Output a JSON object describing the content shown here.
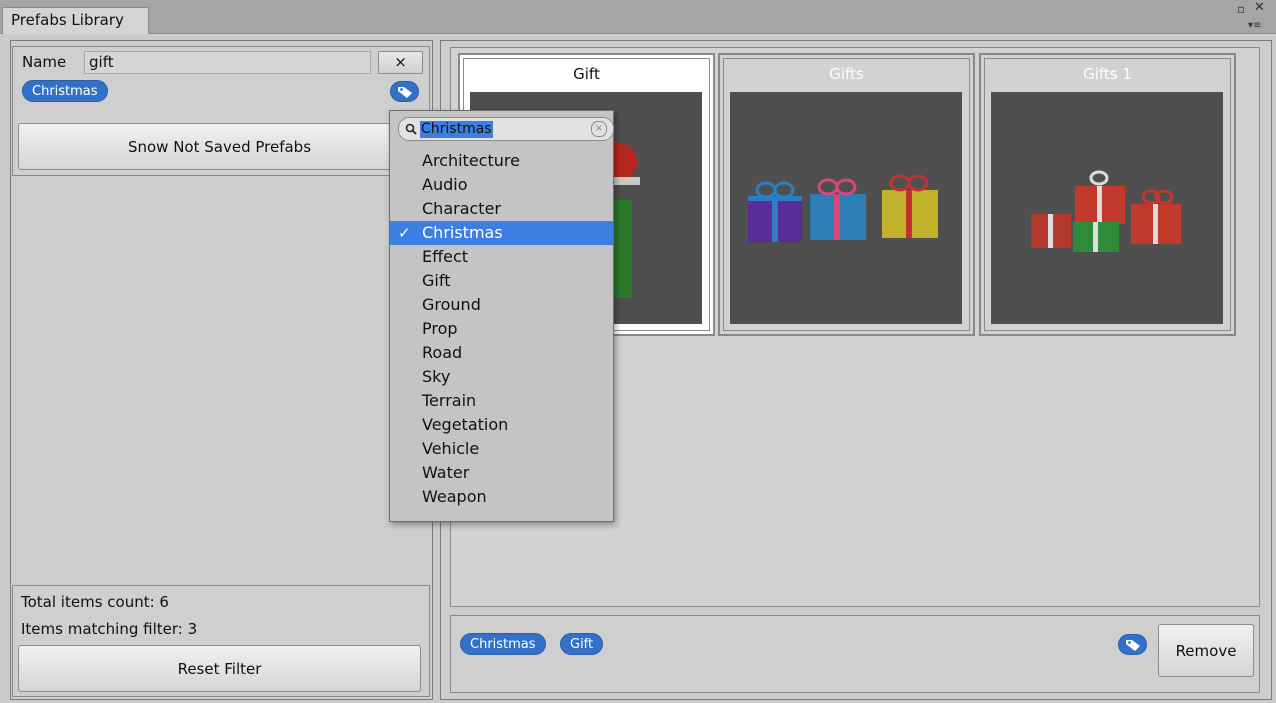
{
  "window": {
    "tab_title": "Prefabs Library",
    "ctrl_maximize": "▫",
    "ctrl_close": "✕",
    "ctrl_menu": "▾≡"
  },
  "filter": {
    "name_label": "Name",
    "name_value": "gift",
    "clear_button": "×",
    "active_tags": [
      "Christmas"
    ],
    "snow_button": "Snow Not Saved Prefabs"
  },
  "info": {
    "total_items": "Total items count: 6",
    "matching_items": "Items matching filter: 3",
    "reset_button": "Reset Filter"
  },
  "grid": {
    "cards": [
      {
        "title": "Gift",
        "selected": true
      },
      {
        "title": "Gifts",
        "selected": false
      },
      {
        "title": "Gifts 1",
        "selected": false
      }
    ]
  },
  "selection": {
    "tags": [
      "Christmas",
      "Gift"
    ],
    "remove_button": "Remove"
  },
  "tag_dropdown": {
    "search_value": "Christmas",
    "items": [
      {
        "label": "Architecture",
        "checked": false
      },
      {
        "label": "Audio",
        "checked": false
      },
      {
        "label": "Character",
        "checked": false
      },
      {
        "label": "Christmas",
        "checked": true
      },
      {
        "label": "Effect",
        "checked": false
      },
      {
        "label": "Gift",
        "checked": false
      },
      {
        "label": "Ground",
        "checked": false
      },
      {
        "label": "Prop",
        "checked": false
      },
      {
        "label": "Road",
        "checked": false
      },
      {
        "label": "Sky",
        "checked": false
      },
      {
        "label": "Terrain",
        "checked": false
      },
      {
        "label": "Vegetation",
        "checked": false
      },
      {
        "label": "Vehicle",
        "checked": false
      },
      {
        "label": "Water",
        "checked": false
      },
      {
        "label": "Weapon",
        "checked": false
      }
    ],
    "check_glyph": "✓"
  },
  "colors": {
    "accent": "#3c7fe0",
    "chip": "#3370c8",
    "preview_bg": "#4f4f4f"
  }
}
